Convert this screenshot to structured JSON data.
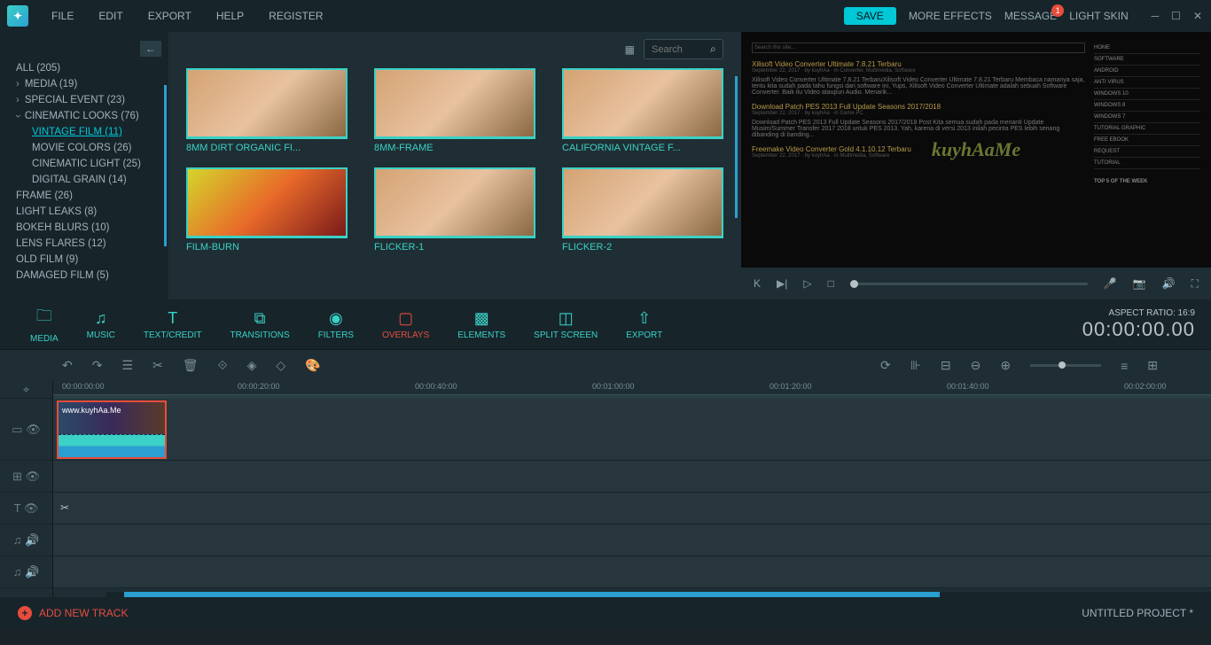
{
  "menubar": {
    "file": "FILE",
    "edit": "EDIT",
    "export": "EXPORT",
    "help": "HELP",
    "register": "REGISTER"
  },
  "topbar": {
    "save": "SAVE",
    "more_effects": "MORE EFFECTS",
    "message": "MESSAGE",
    "message_badge": "1",
    "light_skin": "LIGHT SKIN"
  },
  "sidebar": {
    "items": [
      {
        "label": "ALL (205)"
      },
      {
        "label": "MEDIA (19)"
      },
      {
        "label": "SPECIAL EVENT (23)"
      },
      {
        "label": "CINEMATIC LOOKS (76)"
      },
      {
        "label": "VINTAGE FILM (11)"
      },
      {
        "label": "MOVIE COLORS (26)"
      },
      {
        "label": "CINEMATIC LIGHT (25)"
      },
      {
        "label": "DIGITAL GRAIN (14)"
      },
      {
        "label": "FRAME (26)"
      },
      {
        "label": "LIGHT LEAKS (8)"
      },
      {
        "label": "BOKEH BLURS (10)"
      },
      {
        "label": "LENS FLARES (12)"
      },
      {
        "label": "OLD FILM (9)"
      },
      {
        "label": "DAMAGED FILM (5)"
      }
    ]
  },
  "search": {
    "placeholder": "Search"
  },
  "gallery": {
    "items": [
      {
        "label": "8MM DIRT ORGANIC FI..."
      },
      {
        "label": "8MM-FRAME"
      },
      {
        "label": "CALIFORNIA VINTAGE F..."
      },
      {
        "label": "FILM-BURN"
      },
      {
        "label": "FLICKER-1"
      },
      {
        "label": "FLICKER-2"
      }
    ]
  },
  "preview": {
    "watermark": "kuyhAaMe",
    "search_site": "Search this site...",
    "sidebar": [
      "HOME",
      "SOFTWARE",
      "ANDROID",
      "ANTI VIRUS",
      "WINDOWS 10",
      "WINDOWS 8",
      "WINDOWS 7",
      "TUTORIAL GRAPHIC",
      "FREE EBOOK",
      "REQUEST",
      "TUTORIAL"
    ],
    "top5": "TOP 5 OF THE WEEK",
    "posts": [
      {
        "title": "Xilisoft Video Converter Ultimate 7.8.21 Terbaru",
        "meta": "September 22, 2017 · by kuyhAa · in Converter, Multimedia, Software",
        "body": "Xilisoft Video Converter Ultimate 7.8.21 TerbaruXilisoft Video Converter Ultimate 7.8.21 Terbaru Membaca namanya saja, tentu kita sudah pada tahu fungsi dari software ini, Yups, Xilisoft Video Converter Ultimate adalah sebuah Software Converter. Baik itu Video ataupun Audio. Menarik..."
      },
      {
        "title": "Download Patch PES 2013 Full Update Seasons 2017/2018",
        "meta": "September 22, 2017 · by kuyhAa · in Game PC",
        "body": "Download Patch PES 2013 Full Update Seasons 2017/2018 Post Kita semua sudah pada menanti Update Musim/Summer Transfer 2017 2018 untuk PES 2013. Yah, karena di versi 2013 inilah pecinta PES lebih senang dibanding di banding..."
      },
      {
        "title": "Freemake Video Converter Gold 4.1.10.12 Terbaru",
        "meta": "September 22, 2017 · by kuyhAa · in Multimedia, Software"
      }
    ]
  },
  "tabs": {
    "media": "MEDIA",
    "music": "MUSIC",
    "text": "TEXT/CREDIT",
    "transitions": "TRANSITIONS",
    "filters": "FILTERS",
    "overlays": "OVERLAYS",
    "elements": "ELEMENTS",
    "split": "SPLIT SCREEN",
    "export": "EXPORT"
  },
  "aspect": {
    "label": "ASPECT RATIO: 16:9",
    "timecode": "00:00:00.00"
  },
  "ruler": {
    "ticks": [
      "00:00:00:00",
      "00:00:20:00",
      "00:00:40:00",
      "00:01:00:00",
      "00:01:20:00",
      "00:01:40:00",
      "00:02:00:00"
    ]
  },
  "clip": {
    "label": "www.kuyhAa.Me"
  },
  "footer": {
    "add": "ADD NEW TRACK",
    "project": "UNTITLED PROJECT *"
  }
}
